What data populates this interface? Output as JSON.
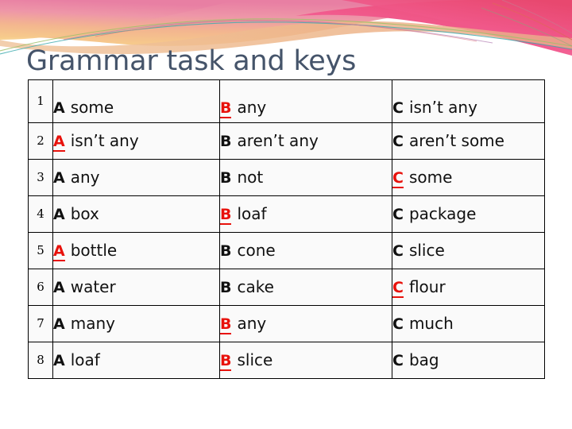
{
  "slide": {
    "title": "Grammar task and keys",
    "title_color": "#45546A",
    "background_color": "#FFFFFF",
    "correct_color": "#E8120C"
  },
  "banner": {
    "name": "decorative-wave-banner",
    "colors": {
      "pink": "#EE7FA6",
      "magenta": "#F04E87",
      "yellow": "#F6CE7B",
      "peach": "#EFB98B",
      "teal": "#35A8A8",
      "green": "#8FBF62",
      "purple": "#B07FB0",
      "red": "#E2645E"
    }
  },
  "table": {
    "name": "grammar-answer-key-table",
    "columns": [
      "#",
      "A",
      "B",
      "C"
    ],
    "rows": [
      {
        "number": "1",
        "options": [
          {
            "letter": "A",
            "text": "some",
            "correct": false
          },
          {
            "letter": "B",
            "text": "any",
            "correct": true
          },
          {
            "letter": "C",
            "text": "isn’t any",
            "correct": false
          }
        ]
      },
      {
        "number": "2",
        "options": [
          {
            "letter": "A",
            "text": "isn’t any",
            "correct": true
          },
          {
            "letter": "B",
            "text": "aren’t any",
            "correct": false
          },
          {
            "letter": "C",
            "text": "aren’t some",
            "correct": false
          }
        ]
      },
      {
        "number": "3",
        "options": [
          {
            "letter": "A",
            "text": "any",
            "correct": false
          },
          {
            "letter": "B",
            "text": "not",
            "correct": false
          },
          {
            "letter": "C",
            "text": "some",
            "correct": true
          }
        ]
      },
      {
        "number": "4",
        "options": [
          {
            "letter": "A",
            "text": "box",
            "correct": false
          },
          {
            "letter": "B",
            "text": "loaf",
            "correct": true
          },
          {
            "letter": "C",
            "text": "package",
            "correct": false
          }
        ]
      },
      {
        "number": "5",
        "options": [
          {
            "letter": "A",
            "text": "bottle",
            "correct": true
          },
          {
            "letter": "B",
            "text": "cone",
            "correct": false
          },
          {
            "letter": "C",
            "text": "slice",
            "correct": false
          }
        ]
      },
      {
        "number": "6",
        "options": [
          {
            "letter": "A",
            "text": "water",
            "correct": false
          },
          {
            "letter": "B",
            "text": "cake",
            "correct": false
          },
          {
            "letter": "C",
            "text": "flour",
            "correct": true
          }
        ]
      },
      {
        "number": "7",
        "options": [
          {
            "letter": "A",
            "text": "many",
            "correct": false
          },
          {
            "letter": "B",
            "text": "any",
            "correct": true
          },
          {
            "letter": "C",
            "text": "much",
            "correct": false
          }
        ]
      },
      {
        "number": "8",
        "options": [
          {
            "letter": "A",
            "text": "loaf",
            "correct": false
          },
          {
            "letter": "B",
            "text": "slice",
            "correct": true
          },
          {
            "letter": "C",
            "text": "bag",
            "correct": false
          }
        ]
      }
    ]
  }
}
